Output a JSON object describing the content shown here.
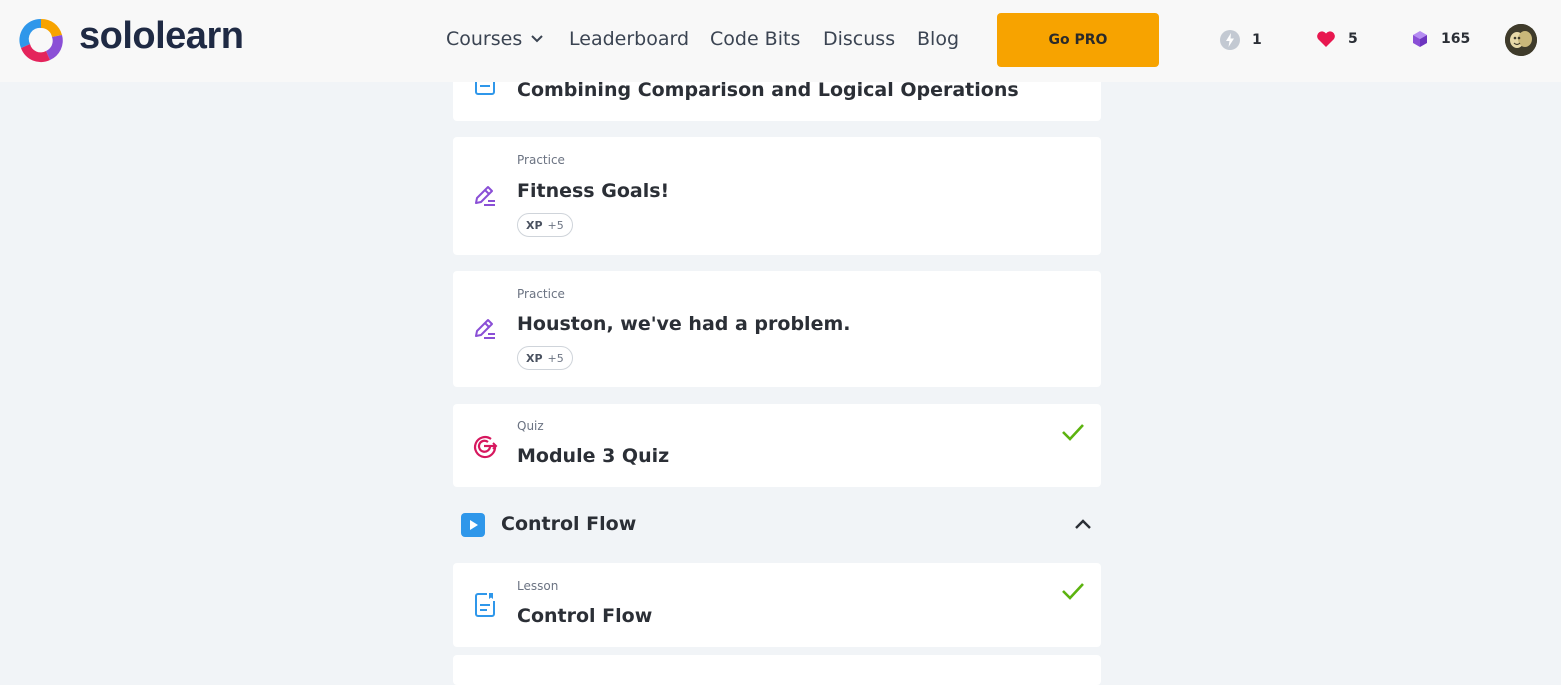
{
  "brand": {
    "name": "sololearn"
  },
  "nav": {
    "courses": "Courses",
    "leaderboard": "Leaderboard",
    "code_bits": "Code Bits",
    "discuss": "Discuss",
    "blog": "Blog"
  },
  "go_pro_label": "Go PRO",
  "stats": {
    "streak": "1",
    "hearts": "5",
    "gems": "165"
  },
  "colors": {
    "accent": "#f7a300",
    "practice_icon": "#8a4fd6",
    "quiz_icon": "#d6175e",
    "lesson_icon": "#2f97ea",
    "check": "#5cb30f"
  },
  "items": [
    {
      "type": "",
      "title": "Combining Comparison and Logical Operations",
      "icon": "lesson-icon"
    },
    {
      "type": "Practice",
      "title": "Fitness Goals!",
      "xp_label": "XP",
      "xp_value": "+5",
      "icon": "pencil-icon"
    },
    {
      "type": "Practice",
      "title": "Houston, we've had a problem.",
      "xp_label": "XP",
      "xp_value": "+5",
      "icon": "pencil-icon"
    },
    {
      "type": "Quiz",
      "title": "Module 3 Quiz",
      "icon": "target-icon",
      "completed": true
    }
  ],
  "section": {
    "title": "Control Flow",
    "icon": "play-icon",
    "expanded": true
  },
  "section_items": [
    {
      "type": "Lesson",
      "title": "Control Flow",
      "icon": "lesson-icon",
      "completed": true
    }
  ]
}
